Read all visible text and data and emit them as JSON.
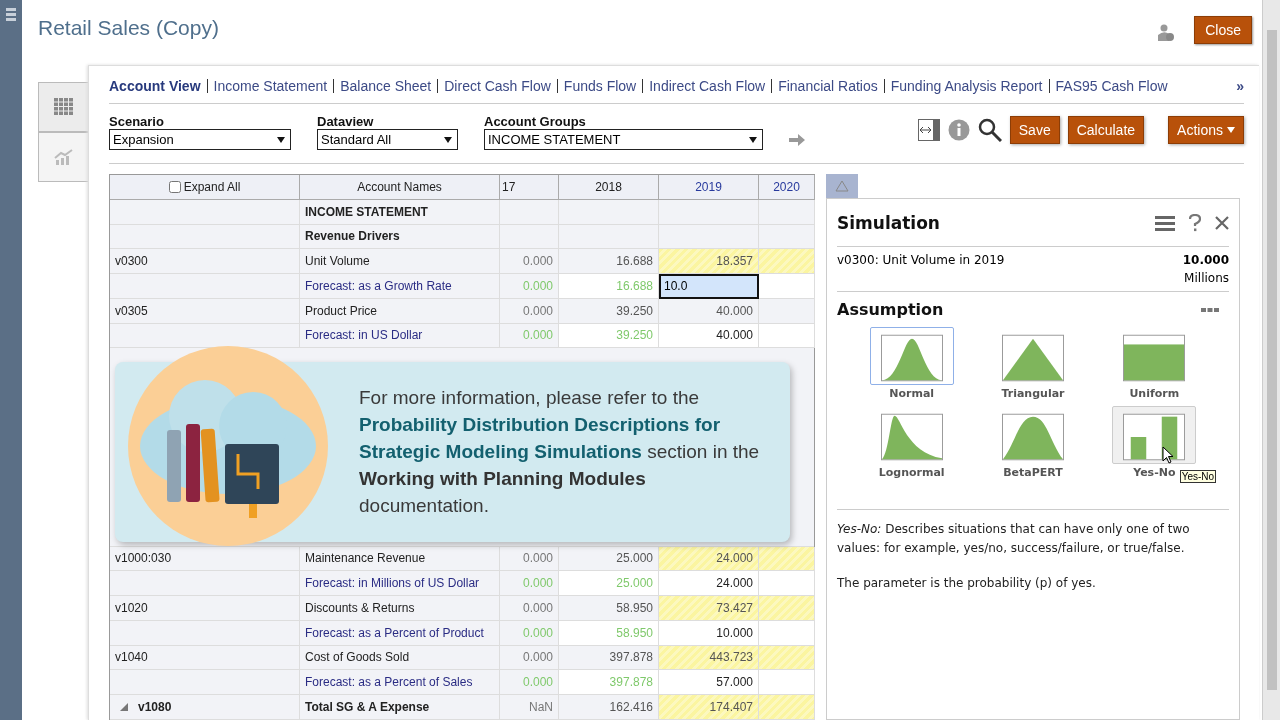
{
  "title": "Retail Sales (Copy)",
  "close_button": "Close",
  "tabs": [
    {
      "label": "Account View",
      "selected": true
    },
    {
      "label": "Income Statement",
      "selected": false
    },
    {
      "label": "Balance Sheet",
      "selected": false
    },
    {
      "label": "Direct Cash Flow",
      "selected": false
    },
    {
      "label": "Funds Flow",
      "selected": false
    },
    {
      "label": "Indirect Cash Flow",
      "selected": false
    },
    {
      "label": "Financial Ratios",
      "selected": false
    },
    {
      "label": "Funding Analysis Report",
      "selected": false
    },
    {
      "label": "FAS95 Cash Flow",
      "selected": false
    }
  ],
  "more_tabs": "»",
  "filters": [
    {
      "label": "Scenario",
      "value": "Expansion"
    },
    {
      "label": "Dataview",
      "value": "Standard All"
    },
    {
      "label": "Account Groups",
      "value": "INCOME STATEMENT"
    }
  ],
  "buttons": [
    "Save",
    "Calculate"
  ],
  "actions_button": "Actions",
  "table": {
    "expand_all": {
      "label": "Expand All",
      "checked": false
    },
    "columns": [
      "Account Names",
      "17",
      "2018",
      "2019",
      "2020"
    ],
    "rows": [
      {
        "kind": "heading",
        "code": "",
        "name": "INCOME STATEMENT",
        "values": []
      },
      {
        "kind": "heading",
        "code": "",
        "name": "Revenue Drivers",
        "values": []
      },
      {
        "kind": "data",
        "code": "v0300",
        "name": "Unit Volume",
        "values": [
          "0.000",
          "16.688",
          "18.357"
        ],
        "highlight": true
      },
      {
        "kind": "forecast",
        "code": "",
        "name": "Forecast: as a Growth Rate",
        "values": [
          "0.000",
          "16.688",
          "10.0"
        ],
        "editing": true
      },
      {
        "kind": "data",
        "code": "v0305",
        "name": "Product Price",
        "values": [
          "0.000",
          "39.250",
          "40.000"
        ],
        "highlight": false
      },
      {
        "kind": "forecast",
        "code": "",
        "name": "Forecast: in US Dollar",
        "values": [
          "0.000",
          "39.250",
          "40.000"
        ],
        "editing": false
      },
      {
        "kind": "hidden"
      },
      {
        "kind": "data",
        "code": "v1000:030",
        "name": "Maintenance Revenue",
        "values": [
          "0.000",
          "25.000",
          "24.000"
        ],
        "highlight": true
      },
      {
        "kind": "forecast",
        "code": "",
        "name": "Forecast: in Millions of US Dollar",
        "values": [
          "0.000",
          "25.000",
          "24.000"
        ],
        "editing": false
      },
      {
        "kind": "data",
        "code": "v1020",
        "name": "Discounts & Returns",
        "values": [
          "0.000",
          "58.950",
          "73.427"
        ],
        "highlight": true
      },
      {
        "kind": "forecast",
        "code": "",
        "name": "Forecast: as a Percent of Product",
        "values": [
          "0.000",
          "58.950",
          "10.000"
        ],
        "editing": false
      },
      {
        "kind": "data",
        "code": "v1040",
        "name": "Cost of Goods Sold",
        "values": [
          "0.000",
          "397.878",
          "443.723"
        ],
        "highlight": true
      },
      {
        "kind": "forecast",
        "code": "",
        "name": "Forecast: as a Percent of Sales",
        "values": [
          "0.000",
          "397.878",
          "57.000"
        ],
        "editing": false
      },
      {
        "kind": "total",
        "code": "v1080",
        "name": "Total SG & A Expense",
        "values": [
          "NaN",
          "162.416",
          "174.407"
        ],
        "highlight": true,
        "expanded": true
      }
    ]
  },
  "callout": "For more information, please refer to the **Probability Distribution Descriptions for Strategic Modeling Simulations** section in the **Working with Planning Modules** documentation.",
  "simulation": {
    "title": "Simulation",
    "subject": "v0300: Unit Volume in 2019",
    "value": "10.000",
    "unit": "Millions",
    "section": "Assumption",
    "distributions": [
      {
        "kind": "normal",
        "label": "Normal",
        "selected": true,
        "hovered": false
      },
      {
        "kind": "triangular",
        "label": "Triangular",
        "selected": false,
        "hovered": false
      },
      {
        "kind": "uniform",
        "label": "Uniform",
        "selected": false,
        "hovered": false
      },
      {
        "kind": "lognormal",
        "label": "Lognormal",
        "selected": false,
        "hovered": false
      },
      {
        "kind": "betapert",
        "label": "BetaPERT",
        "selected": false,
        "hovered": false
      },
      {
        "kind": "yesno",
        "label": "Yes-No",
        "selected": false,
        "hovered": true
      }
    ],
    "tooltip": "Yes-No",
    "description": "*Yes-No:* Describes situations that can have only one of two values: for example, yes/no, success/failure, or true/false.",
    "note": "The parameter is the probability (p) of yes."
  }
}
